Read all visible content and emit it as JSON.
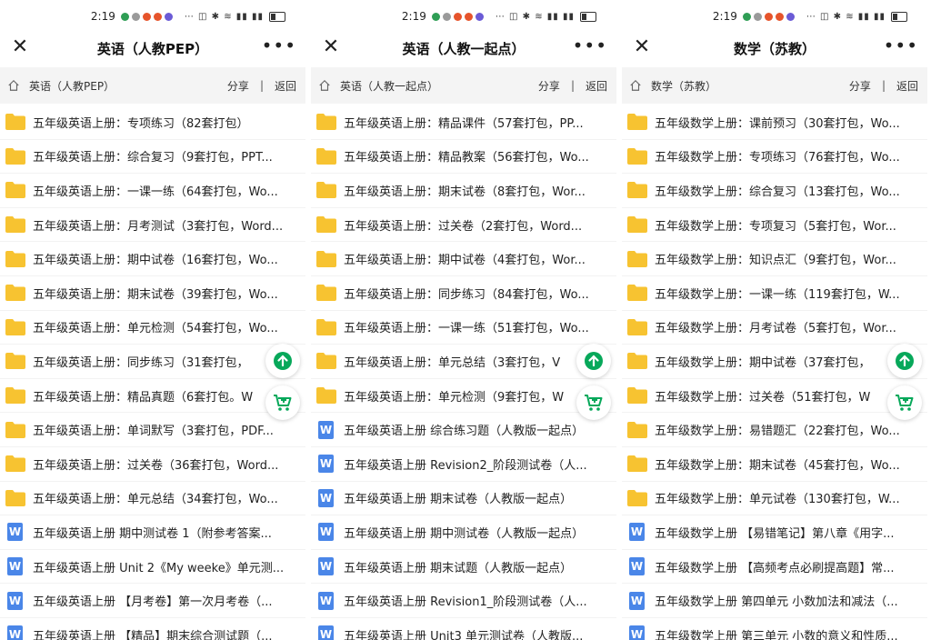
{
  "status": {
    "time": "2:19"
  },
  "panels": [
    {
      "title": "英语（人教PEP）",
      "nav": {
        "path": "英语（人教PEP）",
        "share": "分享",
        "sep": "|",
        "back": "返回"
      },
      "items": [
        {
          "type": "folder",
          "name": "五年级英语上册：专项练习（82套打包）"
        },
        {
          "type": "folder",
          "name": "五年级英语上册：综合复习（9套打包，PPT..."
        },
        {
          "type": "folder",
          "name": "五年级英语上册：一课一练（64套打包，Wo..."
        },
        {
          "type": "folder",
          "name": "五年级英语上册：月考测试（3套打包，Word..."
        },
        {
          "type": "folder",
          "name": "五年级英语上册：期中试卷（16套打包，Wo..."
        },
        {
          "type": "folder",
          "name": "五年级英语上册：期末试卷（39套打包，Wo..."
        },
        {
          "type": "folder",
          "name": "五年级英语上册：单元检测（54套打包，Wo..."
        },
        {
          "type": "folder",
          "name": "五年级英语上册：同步练习（31套打包，"
        },
        {
          "type": "folder",
          "name": "五年级英语上册：精品真题（6套打包。W"
        },
        {
          "type": "folder",
          "name": "五年级英语上册：单词默写（3套打包，PDF..."
        },
        {
          "type": "folder",
          "name": "五年级英语上册：过关卷（36套打包，Word..."
        },
        {
          "type": "folder",
          "name": "五年级英语上册：单元总结（34套打包，Wo..."
        },
        {
          "type": "word",
          "name": "五年级英语上册 期中测试卷 1（附参考答案..."
        },
        {
          "type": "word",
          "name": "五年级英语上册 Unit 2《My weeke》单元测..."
        },
        {
          "type": "word",
          "name": "五年级英语上册 【月考卷】第一次月考卷（..."
        },
        {
          "type": "word",
          "name": "五年级英语上册 【精品】期末综合测试题（..."
        }
      ]
    },
    {
      "title": "英语（人教一起点）",
      "nav": {
        "path": "英语（人教一起点）",
        "share": "分享",
        "sep": "|",
        "back": "返回"
      },
      "items": [
        {
          "type": "folder",
          "name": "五年级英语上册：精品课件（57套打包，PP..."
        },
        {
          "type": "folder",
          "name": "五年级英语上册：精品教案（56套打包，Wo..."
        },
        {
          "type": "folder",
          "name": "五年级英语上册：期末试卷（8套打包，Wor..."
        },
        {
          "type": "folder",
          "name": "五年级英语上册：过关卷（2套打包，Word..."
        },
        {
          "type": "folder",
          "name": "五年级英语上册：期中试卷（4套打包，Wor..."
        },
        {
          "type": "folder",
          "name": "五年级英语上册：同步练习（84套打包，Wo..."
        },
        {
          "type": "folder",
          "name": "五年级英语上册：一课一练（51套打包，Wo..."
        },
        {
          "type": "folder",
          "name": "五年级英语上册：单元总结（3套打包，V"
        },
        {
          "type": "folder",
          "name": "五年级英语上册：单元检测（9套打包，W"
        },
        {
          "type": "word",
          "name": "五年级英语上册 综合练习题（人教版一起点）"
        },
        {
          "type": "word",
          "name": "五年级英语上册 Revision2_阶段测试卷（人..."
        },
        {
          "type": "word",
          "name": "五年级英语上册 期末试卷（人教版一起点）"
        },
        {
          "type": "word",
          "name": "五年级英语上册 期中测试卷（人教版一起点）"
        },
        {
          "type": "word",
          "name": "五年级英语上册 期末试题（人教版一起点）"
        },
        {
          "type": "word",
          "name": "五年级英语上册 Revision1_阶段测试卷（人..."
        },
        {
          "type": "word",
          "name": "五年级英语上册 Unit3 单元测试卷（人教版..."
        }
      ]
    },
    {
      "title": "数学（苏教）",
      "nav": {
        "path": "数学（苏教）",
        "share": "分享",
        "sep": "|",
        "back": "返回"
      },
      "items": [
        {
          "type": "folder",
          "name": "五年级数学上册：课前预习（30套打包，Wo..."
        },
        {
          "type": "folder",
          "name": "五年级数学上册：专项练习（76套打包，Wo..."
        },
        {
          "type": "folder",
          "name": "五年级数学上册：综合复习（13套打包，Wo..."
        },
        {
          "type": "folder",
          "name": "五年级数学上册：专项复习（5套打包，Wor..."
        },
        {
          "type": "folder",
          "name": "五年级数学上册：知识点汇（9套打包，Wor..."
        },
        {
          "type": "folder",
          "name": "五年级数学上册：一课一练（119套打包，W..."
        },
        {
          "type": "folder",
          "name": "五年级数学上册：月考试卷（5套打包，Wor..."
        },
        {
          "type": "folder",
          "name": "五年级数学上册：期中试卷（37套打包，"
        },
        {
          "type": "folder",
          "name": "五年级数学上册：过关卷（51套打包，W"
        },
        {
          "type": "folder",
          "name": "五年级数学上册：易错题汇（22套打包，Wo..."
        },
        {
          "type": "folder",
          "name": "五年级数学上册：期末试卷（45套打包，Wo..."
        },
        {
          "type": "folder",
          "name": "五年级数学上册：单元试卷（130套打包，W..."
        },
        {
          "type": "word",
          "name": "五年级数学上册 【易错笔记】第八章《用字..."
        },
        {
          "type": "word",
          "name": "五年级数学上册 【高频考点必刷提高题】常..."
        },
        {
          "type": "word",
          "name": "五年级数学上册 第四单元 小数加法和减法（..."
        },
        {
          "type": "word",
          "name": "五年级数学上册 第三单元 小数的意义和性质..."
        }
      ]
    }
  ],
  "icons": {
    "word_glyph": "W",
    "folder_color": "#f7c331",
    "word_color": "#4a86e8",
    "fab_color": "#07a85a"
  }
}
